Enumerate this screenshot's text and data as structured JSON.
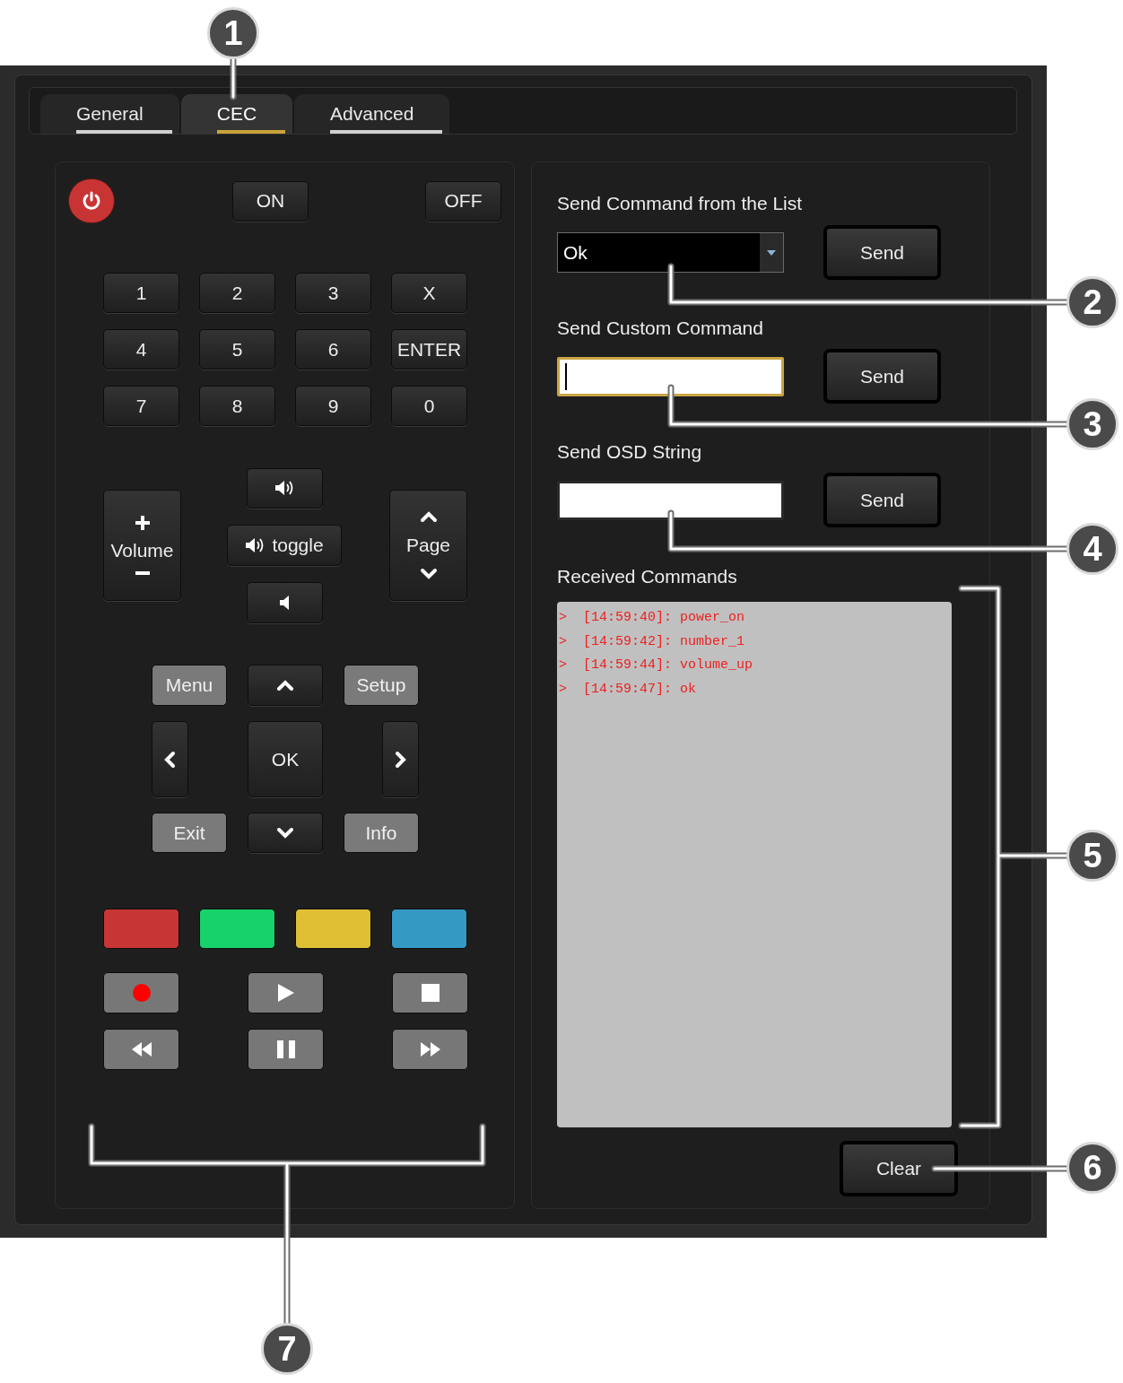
{
  "tabs": [
    {
      "label": "General",
      "selected": false
    },
    {
      "label": "CEC",
      "selected": true
    },
    {
      "label": "Advanced",
      "selected": false
    }
  ],
  "remote": {
    "on_label": "ON",
    "off_label": "OFF",
    "keypad": [
      "1",
      "2",
      "3",
      "X",
      "4",
      "5",
      "6",
      "ENTER",
      "7",
      "8",
      "9",
      "0"
    ],
    "volume_label": "Volume",
    "toggle_label": "toggle",
    "page_label": "Page",
    "nav": {
      "menu": "Menu",
      "setup": "Setup",
      "ok": "OK",
      "exit": "Exit",
      "info": "Info"
    },
    "color_keys": [
      {
        "color": "#c73535"
      },
      {
        "color": "#17d16b"
      },
      {
        "color": "#e1bf34"
      },
      {
        "color": "#3499c3"
      }
    ],
    "media_keys": [
      {
        "kind": "record"
      },
      {
        "kind": "play"
      },
      {
        "kind": "stop"
      },
      {
        "kind": "rewind"
      },
      {
        "kind": "pause"
      },
      {
        "kind": "forward"
      }
    ]
  },
  "command_list": {
    "label": "Send Command from the List",
    "value": "Ok",
    "button": "Send"
  },
  "custom_command": {
    "label": "Send Custom Command",
    "focused": true,
    "button": "Send"
  },
  "osd_string": {
    "label": "Send OSD String",
    "focused": false,
    "button": "Send"
  },
  "received": {
    "label": "Received Commands",
    "lines": [
      ">  [14:59:40]: power_on",
      ">  [14:59:42]: number_1",
      ">  [14:59:44]: volume_up",
      ">  [14:59:47]: ok"
    ]
  },
  "clear_button": "Clear",
  "callouts": [
    "1",
    "2",
    "3",
    "4",
    "5",
    "6",
    "7"
  ]
}
